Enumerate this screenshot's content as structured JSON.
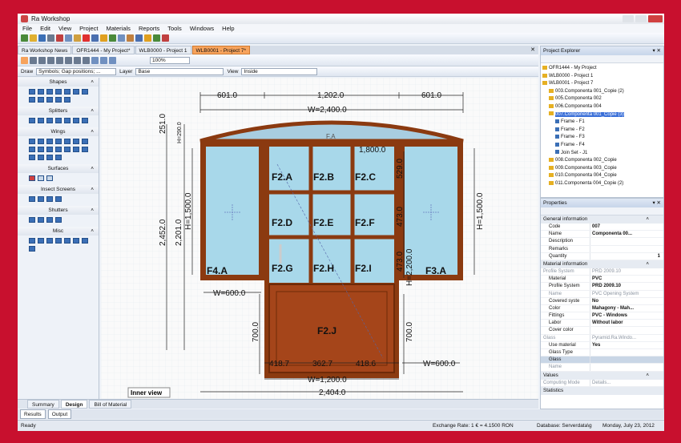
{
  "app": {
    "title": "Ra Workshop"
  },
  "menu": [
    "File",
    "Edit",
    "View",
    "Project",
    "Materials",
    "Reports",
    "Tools",
    "Windows",
    "Help"
  ],
  "tabs": [
    {
      "label": "Ra Workshop News"
    },
    {
      "label": "OFR1444 - My Project*"
    },
    {
      "label": "WLB0000 - Project 1"
    },
    {
      "label": "WLB0001 - Project 7*"
    }
  ],
  "toolbar2": {
    "zoom": "100%"
  },
  "toolbar3": {
    "draw_label": "Draw",
    "draw_value": "Symbols; Gap positions; ...",
    "layer_label": "Layer",
    "layer_value": "Base",
    "view_label": "View",
    "view_value": "Inside"
  },
  "toolbox": {
    "sections": [
      "Shapes",
      "Splitters",
      "Wings",
      "Surfaces",
      "Insect Screens",
      "Shutters",
      "Misc"
    ]
  },
  "drawing": {
    "dims": {
      "top_left": "601.0",
      "top_mid": "1,202.0",
      "top_right": "601.0",
      "total_w": "W=2,400.0",
      "arch_h": "251.0",
      "arch_h2": "H=290.0",
      "overall_h": "2,452.0",
      "overall_h2": "2,201.0",
      "side_h": "H=1,500.0",
      "right_h": "H=1,500.0",
      "door_inner_w": "1,800.0",
      "r529": "529.0",
      "r473a": "473.0",
      "r473b": "473.0",
      "door_h": "H=2,200.0",
      "bottom_l700": "700.0",
      "bottom_r700": "700.0",
      "left_w": "W=600.0",
      "right_w": "W=600.0",
      "b1": "418.7",
      "b2": "362.7",
      "b3": "418.6",
      "door_w": "W=1,200.0",
      "grand_w": "2,404.0"
    },
    "labels": {
      "fa": "F.A",
      "f4a": "F4.A",
      "f3a": "F3.A",
      "f2a": "F2.A",
      "f2b": "F2.B",
      "f2c": "F2.C",
      "f2d": "F2.D",
      "f2e": "F2.E",
      "f2f": "F2.F",
      "f2g": "F2.G",
      "f2h": "F2.H",
      "f2i": "F2.I",
      "f2j": "F2.J"
    },
    "inner_view": "Inner view"
  },
  "bottom_tabs": [
    "Summary",
    "Design",
    "Bill of Material"
  ],
  "output_tabs": [
    "Results",
    "Output"
  ],
  "status": {
    "left": "Ready",
    "exchange": "Exchange Rate: 1 € = 4.1500 RON",
    "db": "Database: Serverdata\\g",
    "date": "Monday, July 23, 2012"
  },
  "explorer": {
    "title": "Project Explorer",
    "items": [
      "OFR1444 - My Project",
      "WLB0000 - Project 1",
      "WLB0001 - Project 7",
      "003.Componenta 001_Copie (2)",
      "005.Componenta 002",
      "006.Componenta 004",
      "007.Componenta 001_Copie (3)",
      "Frame - F1",
      "Frame - F2",
      "Frame - F3",
      "Frame - F4",
      "Join Set - J1",
      "008.Componenta 002_Copie",
      "009.Componenta 003_Copie",
      "010.Componenta 004_Copie",
      "011.Componenta 004_Copie (2)"
    ]
  },
  "properties": {
    "title": "Properties",
    "general": "General information",
    "rows1": [
      [
        "Code",
        "007"
      ],
      [
        "Name",
        "Componenta 00..."
      ],
      [
        "Description",
        ""
      ],
      [
        "Remarks",
        ""
      ],
      [
        "Quantity",
        "1"
      ]
    ],
    "material": "Material information",
    "rows2": [
      [
        "Profile System",
        "PRD 2009.10"
      ],
      [
        "Material",
        "PVC"
      ],
      [
        "Profile System",
        "PRD 2009.10"
      ],
      [
        "Name",
        "PVC Opening System"
      ],
      [
        "Covered syste",
        "No"
      ],
      [
        "Color",
        "Mahagony - Mah..."
      ],
      [
        "Fittings",
        "PVC - Windows"
      ],
      [
        "Labor",
        "Without labor"
      ],
      [
        "Cover color",
        ""
      ],
      [
        "Glass",
        "Pyramid.Ra.Windo..."
      ],
      [
        "Use material",
        "Yes"
      ],
      [
        "Glass Type",
        ""
      ],
      [
        "Glass",
        ""
      ],
      [
        "Name",
        ""
      ]
    ],
    "values": "Values",
    "rows3": [
      [
        "Computing Mode",
        "Details..."
      ]
    ],
    "statistics": "Statistics"
  }
}
